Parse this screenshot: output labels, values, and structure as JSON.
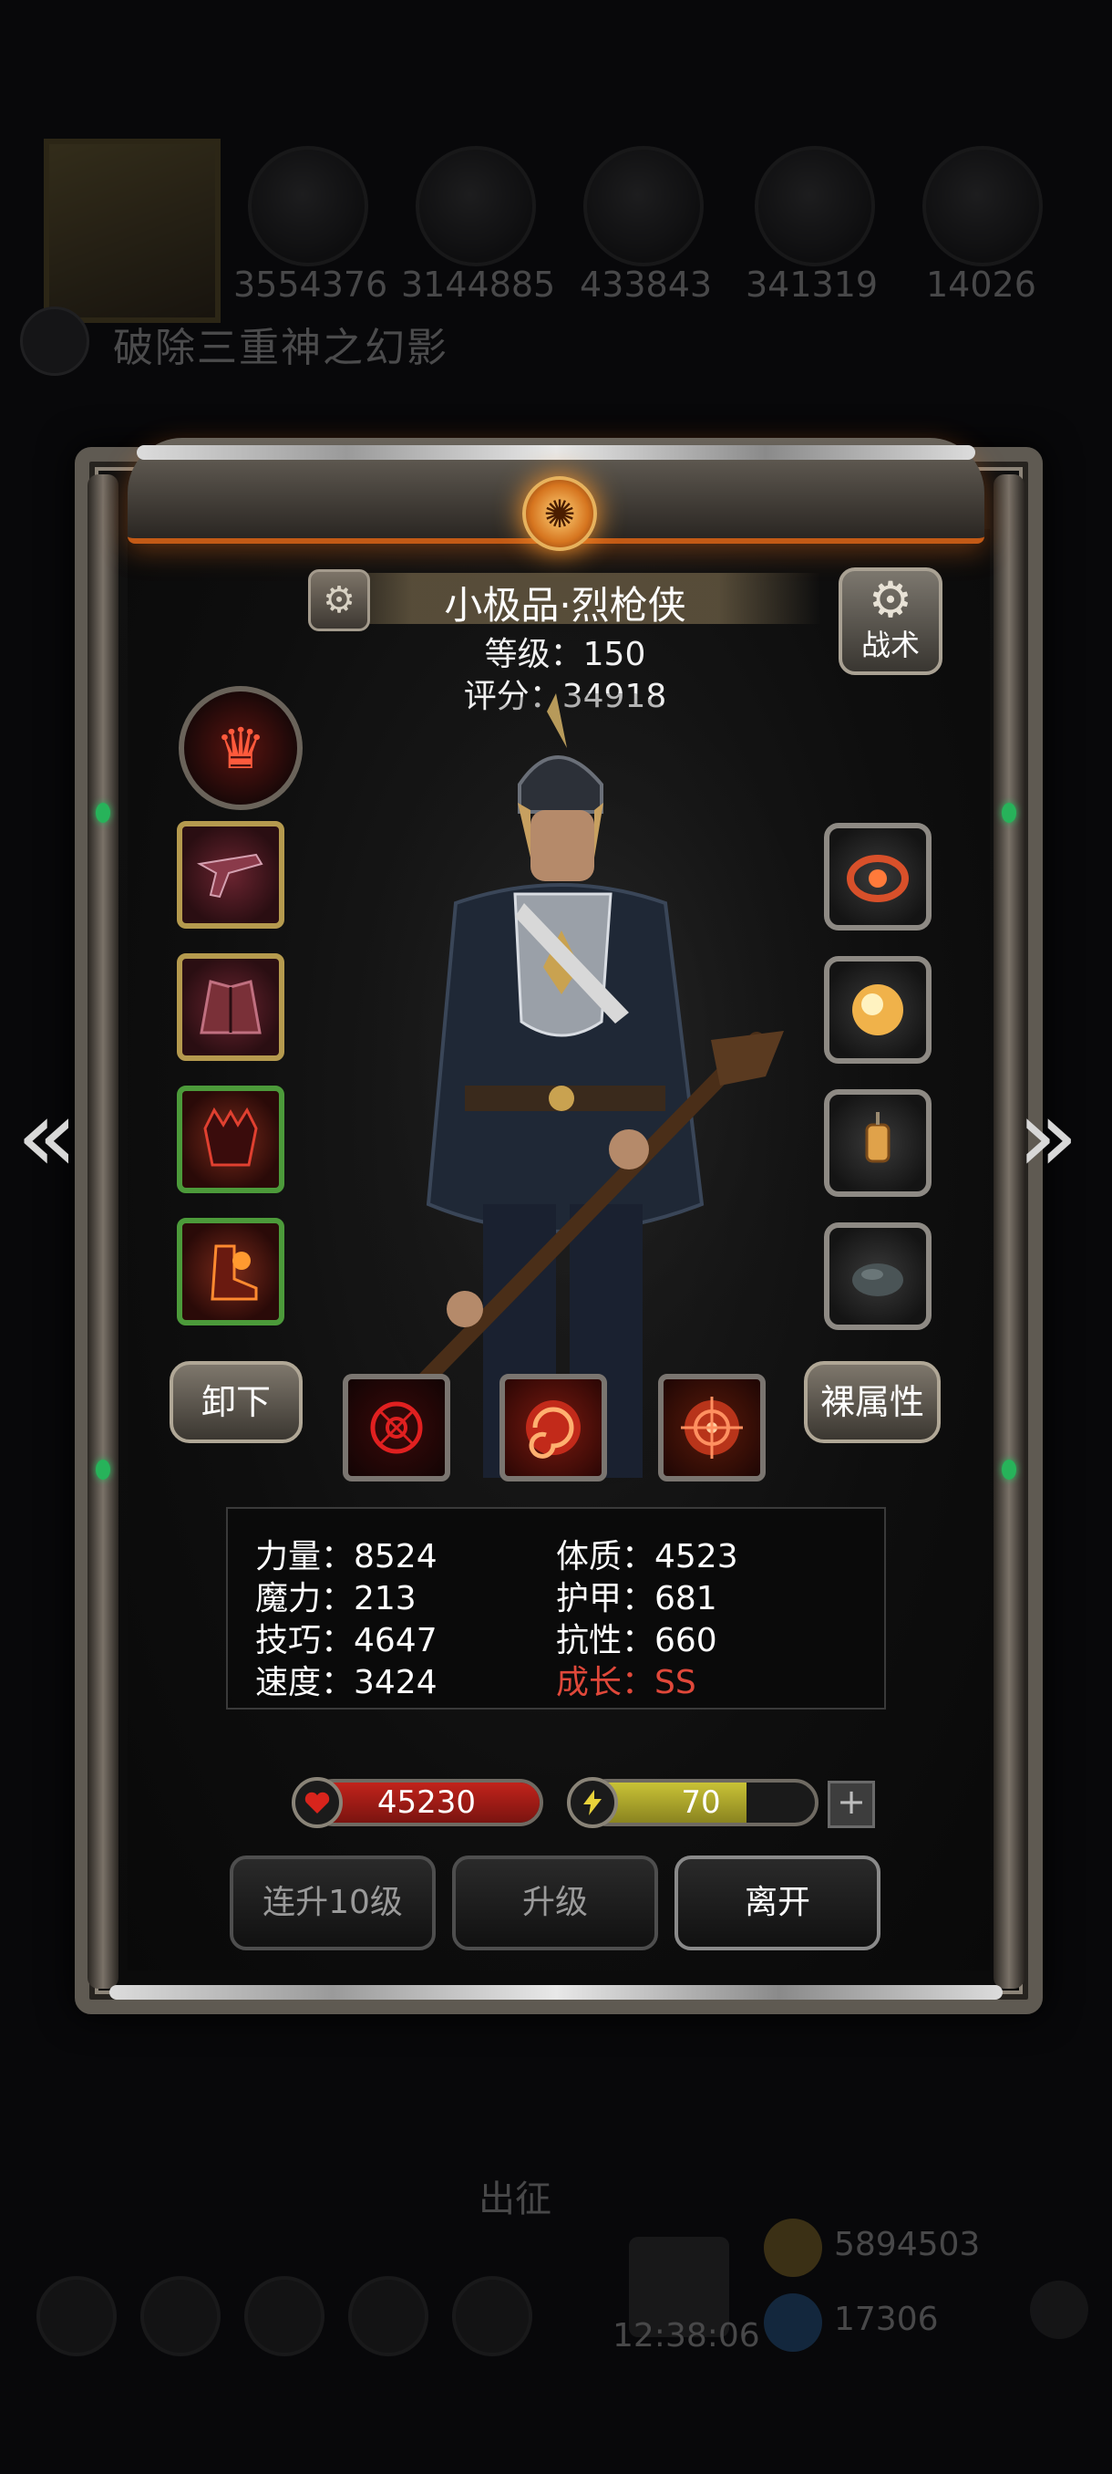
{
  "background_hud": {
    "resources": [
      "3554376",
      "3144885",
      "433843",
      "341319",
      "14026"
    ],
    "quest": "破除三重神之幻影",
    "sortie": "出征",
    "clock": "12:38:06",
    "currency_1": "5894503",
    "currency_2": "17306"
  },
  "header": {
    "title": "小极品·烈枪侠",
    "level": "等级：150",
    "score": "评分：34918",
    "tactics_label": "战术",
    "tactics_icon": "gear-icon"
  },
  "class_emblem": {
    "icon": "flame-crest-icon"
  },
  "left_slots": [
    {
      "name": "weapon-slot",
      "icon": "rifle-icon",
      "rarity": "gold"
    },
    {
      "name": "armor-slot",
      "icon": "coat-icon",
      "rarity": "gold"
    },
    {
      "name": "helmet-slot",
      "icon": "demon-helm-icon",
      "rarity": "green"
    },
    {
      "name": "boots-slot",
      "icon": "fire-boots-icon",
      "rarity": "green"
    }
  ],
  "right_slots": [
    {
      "name": "amulet-slot",
      "icon": "fire-ring-icon"
    },
    {
      "name": "orb-slot",
      "icon": "glow-orb-icon"
    },
    {
      "name": "lantern-slot",
      "icon": "lantern-icon"
    },
    {
      "name": "stone-slot",
      "icon": "stone-icon"
    }
  ],
  "actions": {
    "unequip": "卸下",
    "base_attributes": "裸属性"
  },
  "skills": [
    {
      "name": "skill-crosshair",
      "icon": "crosshair-icon"
    },
    {
      "name": "skill-vortex",
      "icon": "vortex-icon"
    },
    {
      "name": "skill-target",
      "icon": "target-icon"
    }
  ],
  "stats": {
    "strength": "力量：8524",
    "constitution": "体质：4523",
    "magic": "魔力：213",
    "armor": "护甲：681",
    "skill": "技巧：4647",
    "resistance": "抗性：660",
    "speed": "速度：3424",
    "growth": "成长：SS"
  },
  "bars": {
    "hp_value": "45230",
    "hp_fill": 1.0,
    "energy_value": "70",
    "energy_fill": 0.7,
    "hp_color": "#c2231b",
    "energy_color": "#c9c236"
  },
  "buttons": {
    "level_up_10": "连升10级",
    "level_up": "升级",
    "leave": "离开"
  },
  "colors": {
    "growth_red": "#e0483a",
    "accent_orange": "#d6751f"
  }
}
